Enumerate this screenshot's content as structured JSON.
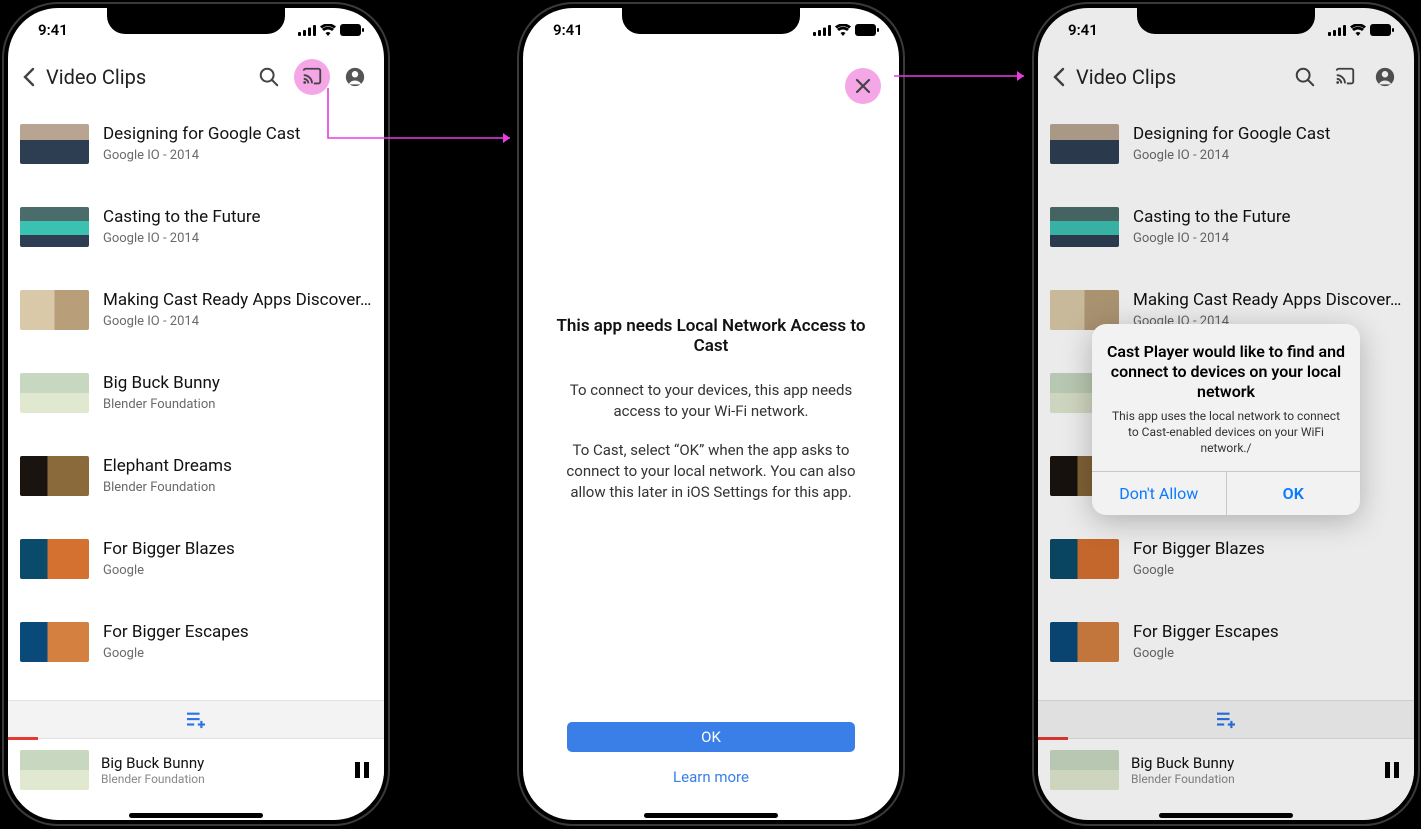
{
  "status": {
    "time": "9:41"
  },
  "appbar": {
    "title": "Video Clips"
  },
  "videos": [
    {
      "title": "Designing for Google Cast",
      "subtitle": "Google IO - 2014",
      "thumbClass": "t1"
    },
    {
      "title": "Casting to the Future",
      "subtitle": "Google IO - 2014",
      "thumbClass": "t2"
    },
    {
      "title": "Making Cast Ready Apps Discover...",
      "subtitle": "Google IO - 2014",
      "thumbClass": "t3"
    },
    {
      "title": "Big Buck Bunny",
      "subtitle": "Blender Foundation",
      "thumbClass": "t4"
    },
    {
      "title": "Elephant Dreams",
      "subtitle": "Blender Foundation",
      "thumbClass": "t5"
    },
    {
      "title": "For Bigger Blazes",
      "subtitle": "Google",
      "thumbClass": "t6"
    },
    {
      "title": "For Bigger Escapes",
      "subtitle": "Google",
      "thumbClass": "t7"
    }
  ],
  "nowPlaying": {
    "title": "Big Buck Bunny",
    "subtitle": "Blender Foundation",
    "thumbClass": "t4"
  },
  "interstitial": {
    "heading": "This app needs Local Network Access to Cast",
    "p1": "To connect to your devices, this app needs access to your Wi-Fi network.",
    "p2": "To Cast, select “OK” when the app asks to connect to your local network. You can also allow this later in iOS Settings for this app.",
    "ok": "OK",
    "learn": "Learn more"
  },
  "alert": {
    "title": "Cast Player would like to find and connect to devices on your local network",
    "message": "This app uses the local network to connect to Cast-enabled devices on your WiFi network./",
    "deny": "Don't Allow",
    "allow": "OK"
  }
}
